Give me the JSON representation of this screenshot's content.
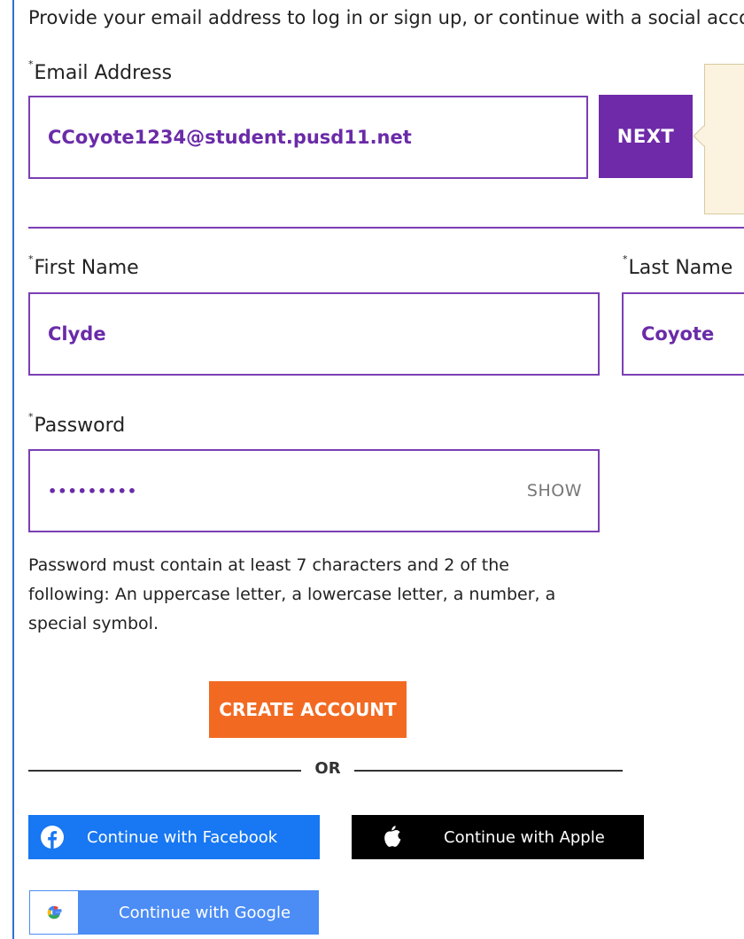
{
  "intro": "Provide your email address to log in or sign up, or continue with a social account.",
  "email": {
    "label": "Email Address",
    "value": "CCoyote1234@student.pusd11.net",
    "next_label": "NEXT"
  },
  "first_name": {
    "label": "First Name",
    "value": "Clyde"
  },
  "last_name": {
    "label": "Last Name",
    "value": "Coyote"
  },
  "password": {
    "label": "Password",
    "value": "•••••••••",
    "show_label": "SHOW"
  },
  "hint": "Password must contain at least 7 characters and 2 of the following: An uppercase letter, a lowercase letter, a number, a special symbol.",
  "create_label": "CREATE ACCOUNT",
  "or_label": "OR",
  "required_mark": "*",
  "social": {
    "facebook": "Continue with Facebook",
    "apple": "Continue with Apple",
    "google": "Continue with Google"
  },
  "icons": {
    "facebook": "facebook-icon",
    "apple": "apple-icon",
    "google": "google-icon"
  },
  "colors": {
    "accent": "#6e2aa8",
    "create": "#f26a22",
    "facebook": "#1877f2",
    "google": "#4b8cf5"
  }
}
